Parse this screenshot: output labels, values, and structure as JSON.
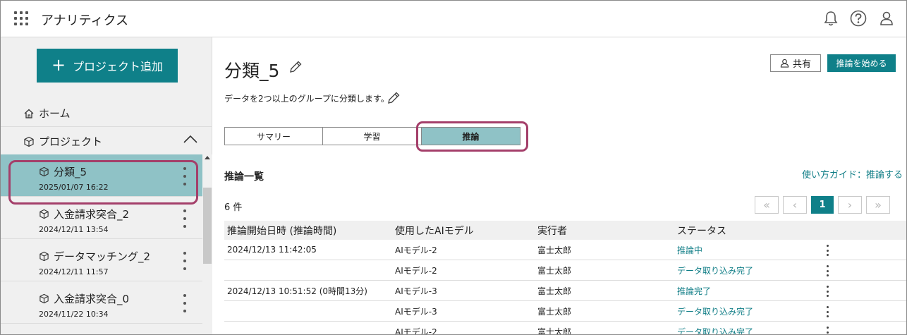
{
  "header": {
    "app_title": "アナリティクス"
  },
  "sidebar": {
    "add_project_label": "プロジェクト追加",
    "home_label": "ホーム",
    "projects_label": "プロジェクト",
    "projects": [
      {
        "name": "分類_5",
        "date": "2025/01/07 16:22",
        "active": true
      },
      {
        "name": "入金請求突合_2",
        "date": "2024/12/11 13:54"
      },
      {
        "name": "データマッチング_2",
        "date": "2024/12/11 11:57"
      },
      {
        "name": "入金請求突合_0",
        "date": "2024/11/22 10:34"
      }
    ]
  },
  "main": {
    "title": "分類_5",
    "description": "データを2つ以上のグループに分類します。",
    "share_label": "共有",
    "start_inference_label": "推論を始める",
    "tabs": [
      {
        "label": "サマリー"
      },
      {
        "label": "学習"
      },
      {
        "label": "推論",
        "active": true
      }
    ],
    "section_title": "推論一覧",
    "guide_link": "使い方ガイド：推論する",
    "count_text": "6 件",
    "pagination": {
      "current_page": "1"
    },
    "table": {
      "columns": [
        "推論開始日時 (推論時間)",
        "使用したAIモデル",
        "実行者",
        "ステータス"
      ],
      "rows": [
        {
          "start": "2024/12/13 11:42:05",
          "model": "AIモデル-2",
          "user": "富士太郎",
          "status": "推論中"
        },
        {
          "start": "",
          "model": "AIモデル-2",
          "user": "富士太郎",
          "status": "データ取り込み完了"
        },
        {
          "start": "2024/12/13 10:51:52 (0時間13分)",
          "model": "AIモデル-3",
          "user": "富士太郎",
          "status": "推論完了"
        },
        {
          "start": "",
          "model": "AIモデル-3",
          "user": "富士太郎",
          "status": "データ取り込み完了"
        },
        {
          "start": "",
          "model": "AIモデル-2",
          "user": "富士太郎",
          "status": "データ取り込み完了"
        }
      ]
    }
  },
  "colors": {
    "accent": "#0f8089",
    "active_bg": "#8fc2c6",
    "highlight_ring": "#a43f6a",
    "link": "#0f7d86"
  }
}
